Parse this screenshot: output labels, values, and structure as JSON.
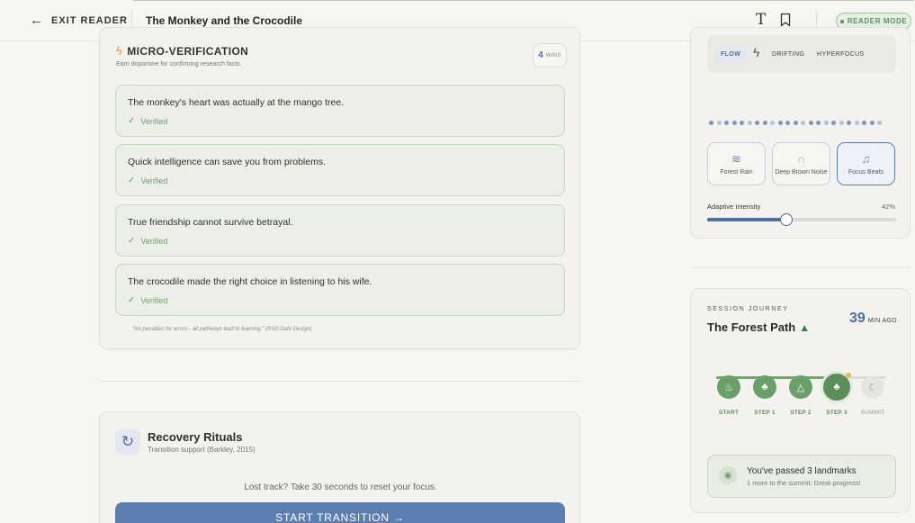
{
  "header": {
    "exit_label": "EXIT READER",
    "book_title": "The Monkey and the Crocodile",
    "font_glyph": "T",
    "reader_mode_label": "READER MODE"
  },
  "micro_verification": {
    "title": "MICRO-VERIFICATION",
    "subtitle": "Earn dopamine for confirming research facts",
    "wins_count": "4",
    "wins_label": "WINS",
    "facts": [
      {
        "text": "The monkey's heart was actually at the mango tree.",
        "status": "Verified"
      },
      {
        "text": "Quick intelligence can save you from problems.",
        "status": "Verified"
      },
      {
        "text": "True friendship cannot survive betrayal.",
        "status": "Verified"
      },
      {
        "text": "The crocodile made the right choice in listening to his wife.",
        "status": "Verified"
      }
    ],
    "footnote": "\"No penalties for errors - all pathways lead to learning.\" (RSD-Safe Design)"
  },
  "recovery": {
    "title": "Recovery Rituals",
    "subtitle": "Transition support (Barkley, 2015)",
    "prompt": "Lost track? Take 30 seconds to reset your focus.",
    "button_label": "START TRANSITION →"
  },
  "sound": {
    "modes": [
      "FLOW",
      "DRIFTING",
      "HYPERFOCUS"
    ],
    "selected_mode": "FLOW",
    "soundscapes": [
      {
        "label": "Forest Rain",
        "icon": "wind-icon"
      },
      {
        "label": "Deep Brown Noise",
        "icon": "headphones-icon"
      },
      {
        "label": "Focus Beats",
        "icon": "music-note-icon"
      }
    ],
    "selected_soundscape": "Focus Beats",
    "intensity_label": "Adaptive Intensity",
    "intensity_value": "42%",
    "intensity_fraction": 0.42
  },
  "journey": {
    "label": "SESSION JOURNEY",
    "title": "The Forest Path",
    "minutes": "39",
    "minutes_unit": "MIN AGO",
    "steps": [
      {
        "label": "START",
        "icon": "campfire-icon",
        "state": "done"
      },
      {
        "label": "STEP 1",
        "icon": "tree-icon",
        "state": "done"
      },
      {
        "label": "STEP 2",
        "icon": "mountain-icon",
        "state": "done"
      },
      {
        "label": "STEP 3",
        "icon": "tree-icon",
        "state": "current"
      },
      {
        "label": "SUMMIT",
        "icon": "moon-icon",
        "state": "future"
      }
    ],
    "progress_fraction": 0.75,
    "landmark_title": "You've passed 3 landmarks",
    "landmark_sub": "1 more to the summit. Great progress!"
  },
  "colors": {
    "accent_blue": "#4f6fa3",
    "accent_green": "#6b9f69",
    "background": "#f7f6f2"
  }
}
